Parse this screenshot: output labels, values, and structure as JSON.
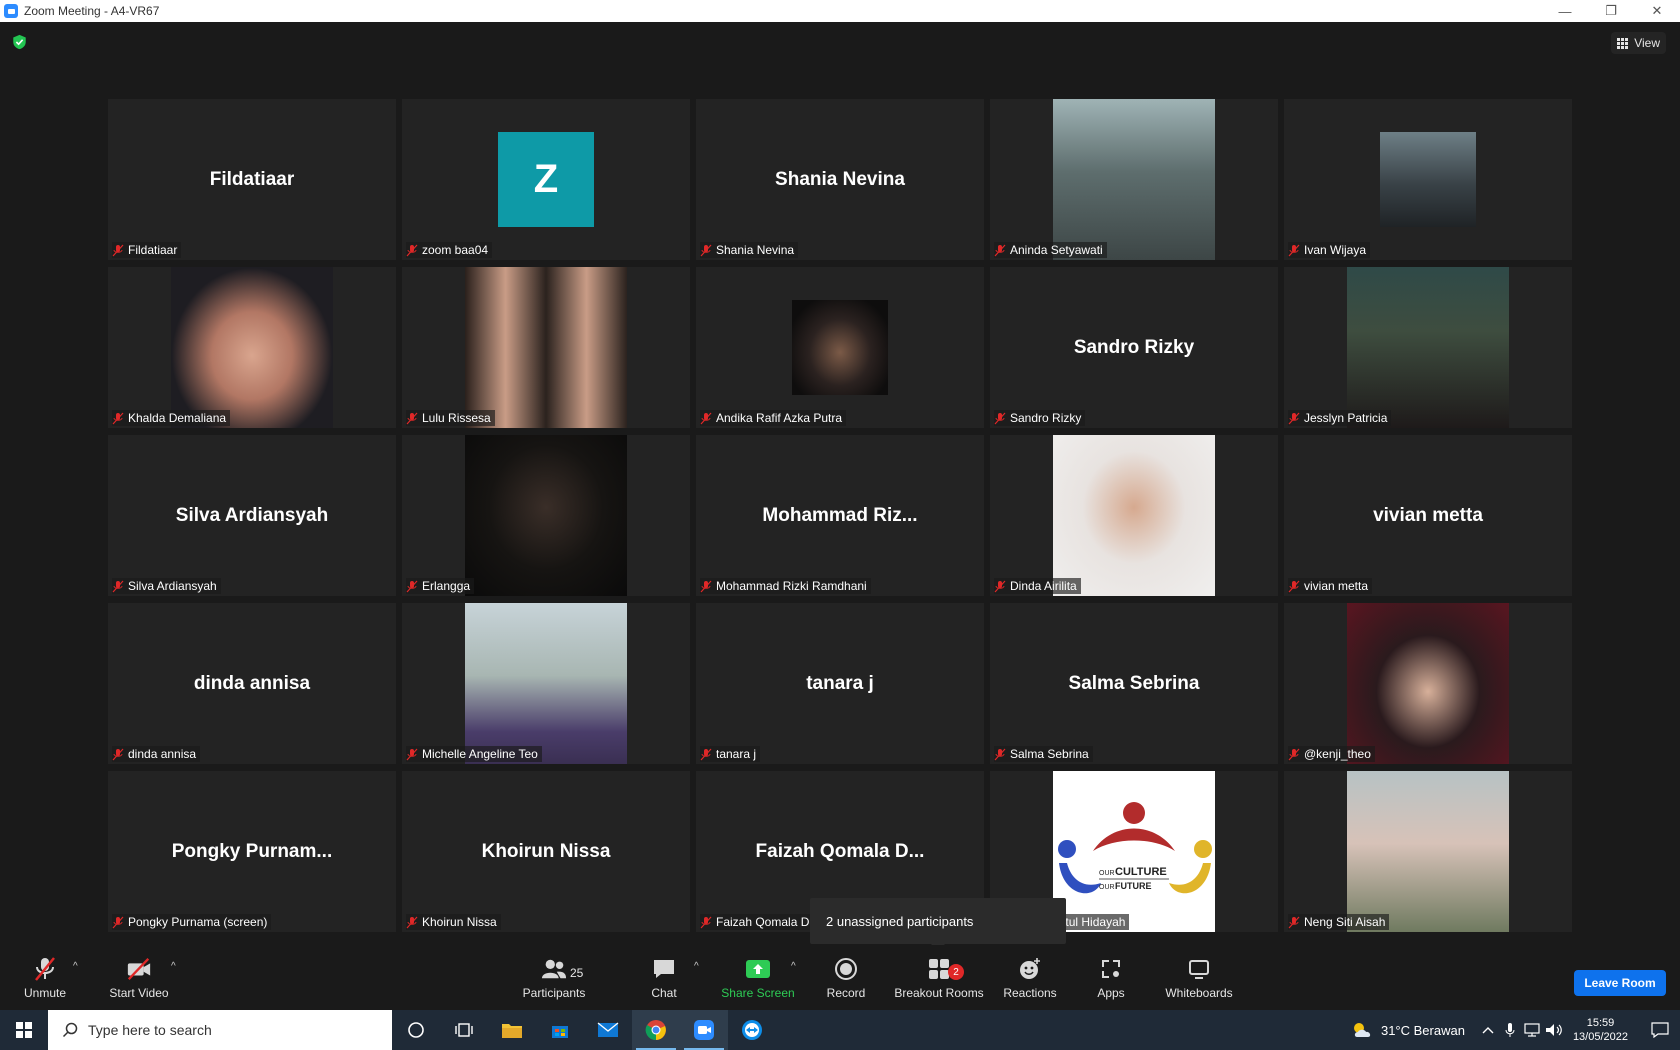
{
  "window": {
    "title": "Zoom Meeting - A4-VR67",
    "minimize": "—",
    "restore": "❐",
    "close": "✕"
  },
  "view_button": {
    "label": "View"
  },
  "tiles": [
    {
      "label": "Fildatiaar",
      "big": "Fildatiaar"
    },
    {
      "label": "zoom baa04",
      "avatar_letter": "Z"
    },
    {
      "label": "Shania Nevina",
      "big": "Shania Nevina"
    },
    {
      "label": "Aninda Setyawati"
    },
    {
      "label": "Ivan Wijaya"
    },
    {
      "label": "Khalda Demaliana"
    },
    {
      "label": "Lulu Rissesa"
    },
    {
      "label": "Andika Rafif Azka Putra"
    },
    {
      "label": "Sandro Rizky",
      "big": "Sandro Rizky"
    },
    {
      "label": "Jesslyn Patricia"
    },
    {
      "label": "Silva Ardiansyah",
      "big": "Silva Ardiansyah"
    },
    {
      "label": "Erlangga"
    },
    {
      "label": "Mohammad Rizki Ramdhani",
      "big": "Mohammad  Riz..."
    },
    {
      "label": "Dinda Airilita"
    },
    {
      "label": "vivian metta",
      "big": "vivian metta"
    },
    {
      "label": "dinda annisa",
      "big": "dinda annisa"
    },
    {
      "label": "Michelle Angeline Teo"
    },
    {
      "label": "tanara j",
      "big": "tanara j"
    },
    {
      "label": "Salma Sebrina",
      "big": "Salma Sebrina"
    },
    {
      "label": "@kenji_theo"
    },
    {
      "label": "Pongky Purnama (screen)",
      "big": "Pongky  Purnam..."
    },
    {
      "label": "Khoirun Nissa",
      "big": "Khoirun Nissa"
    },
    {
      "label": "Faizah Qomala D",
      "big": "Faizah  Qomala  D..."
    },
    {
      "label": "na Azziadayatul Hidayah",
      "logo_line1": "OUR",
      "logo_line2": "CULTURE",
      "logo_line3": "OUR",
      "logo_line4": "FUTURE"
    },
    {
      "label": "Neng Siti Aisah"
    }
  ],
  "tooltip": {
    "text": "2 unassigned participants"
  },
  "toolbar": {
    "unmute": "Unmute",
    "start_video": "Start Video",
    "participants": "Participants",
    "participants_count": "25",
    "chat": "Chat",
    "share_screen": "Share Screen",
    "record": "Record",
    "breakout_rooms": "Breakout Rooms",
    "breakout_badge": "2",
    "reactions": "Reactions",
    "apps": "Apps",
    "whiteboards": "Whiteboards",
    "leave_room": "Leave Room"
  },
  "taskbar": {
    "search_placeholder": "Type here to search",
    "weather": "31°C  Berawan",
    "time": "15:59",
    "date": "13/05/2022"
  },
  "colors": {
    "accent": "#0e72ed",
    "share_green": "#2ecb55",
    "badge_red": "#e02828",
    "avatar_teal": "#0e9aa7"
  }
}
